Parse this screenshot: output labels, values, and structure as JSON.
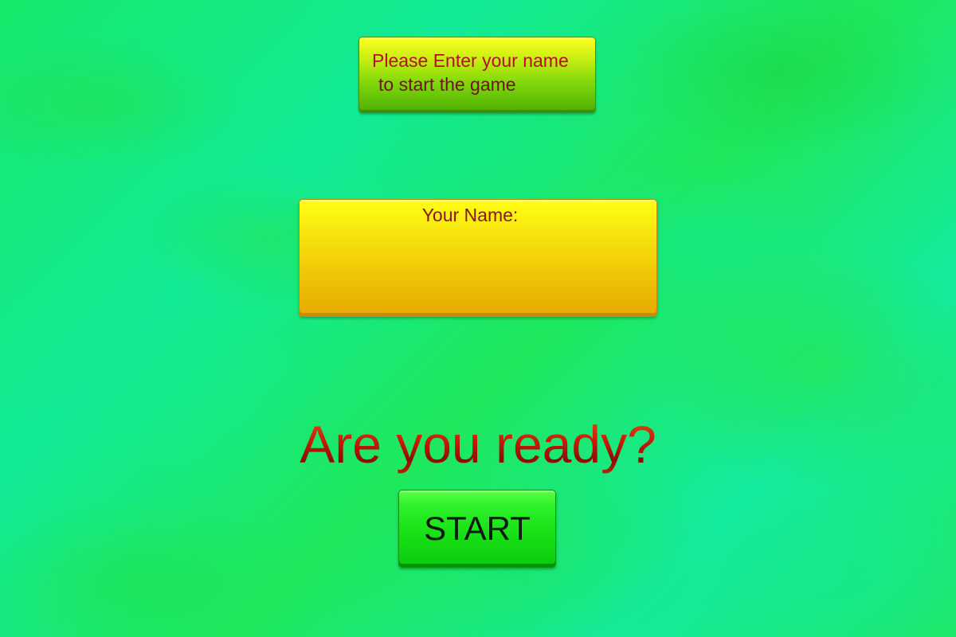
{
  "prompt_panel": {
    "line1": "Please Enter your name",
    "line2": "to start the game"
  },
  "name_field": {
    "label": "Your Name:",
    "value": ""
  },
  "ready_text": "Are you ready?",
  "start_button": {
    "label": "START"
  },
  "colors": {
    "background": "#16e86a",
    "prompt_text": "#b5102a",
    "name_box": "#f5d10a",
    "ready_text": "#c21f0a",
    "start_button": "#16df16"
  }
}
